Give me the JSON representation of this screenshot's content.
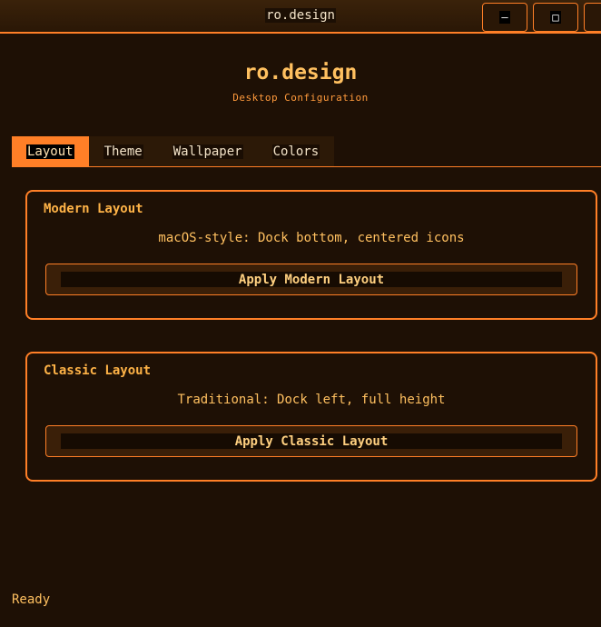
{
  "window": {
    "title": "ro.design",
    "minimize_glyph": "—",
    "maximize_glyph": "□"
  },
  "header": {
    "title": "ro.design",
    "subtitle": "Desktop Configuration"
  },
  "tabs": [
    {
      "label": "Layout",
      "active": true
    },
    {
      "label": "Theme",
      "active": false
    },
    {
      "label": "Wallpaper",
      "active": false
    },
    {
      "label": "Colors",
      "active": false
    }
  ],
  "cards": [
    {
      "title": "Modern Layout",
      "description": "macOS-style: Dock bottom, centered icons",
      "button_label": "Apply Modern Layout"
    },
    {
      "title": "Classic Layout",
      "description": "Traditional: Dock left, full height",
      "button_label": "Apply Classic Layout"
    }
  ],
  "status": {
    "text": "Ready"
  },
  "colors": {
    "accent": "#ff7f27",
    "background": "#1e1005",
    "text": "#ffc060"
  }
}
